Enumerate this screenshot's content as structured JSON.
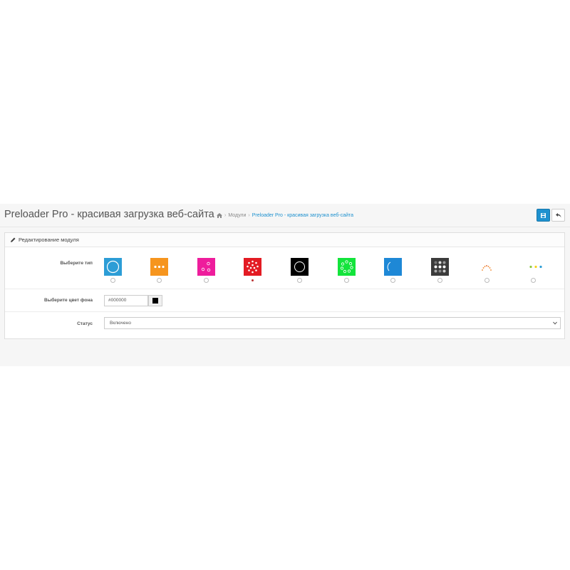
{
  "header": {
    "title": "Preloader Pro - красивая загрузка веб-сайта",
    "breadcrumb": [
      {
        "label": "Модули",
        "active": false
      },
      {
        "label": "Preloader Pro - красивая загрузка веб-сайта",
        "active": true
      }
    ],
    "icons": {
      "home": "home-icon",
      "save": "save-icon",
      "back": "reply-icon"
    }
  },
  "panel": {
    "heading": "Редактирование модуля",
    "heading_icon": "pencil-icon",
    "type_label": "Выберите тип",
    "types": [
      {
        "name": "spinner-ring",
        "bg": "#2c9dd6",
        "selected": false
      },
      {
        "name": "three-dots",
        "bg": "#f6951e",
        "selected": false
      },
      {
        "name": "bouncing-circles",
        "bg": "#ee1d9c",
        "selected": false
      },
      {
        "name": "dot-ring",
        "bg": "#e31b23",
        "selected": true
      },
      {
        "name": "black-ring",
        "bg": "#000000",
        "selected": false
      },
      {
        "name": "green-ring",
        "bg": "#13e43b",
        "selected": false
      },
      {
        "name": "arc-spinner",
        "bg": "#1e88d6",
        "selected": false
      },
      {
        "name": "dot-grid",
        "bg": "#3b3b3b",
        "selected": false
      },
      {
        "name": "orange-dots-arc",
        "bg": "#ffffff",
        "selected": false
      },
      {
        "name": "colored-dots",
        "bg": "#ffffff",
        "selected": false
      }
    ],
    "color_label": "Выберите цвет фона",
    "color_value": "#000000",
    "status_label": "Статус",
    "status_value": "Включено",
    "accent": "#1e91cf"
  }
}
